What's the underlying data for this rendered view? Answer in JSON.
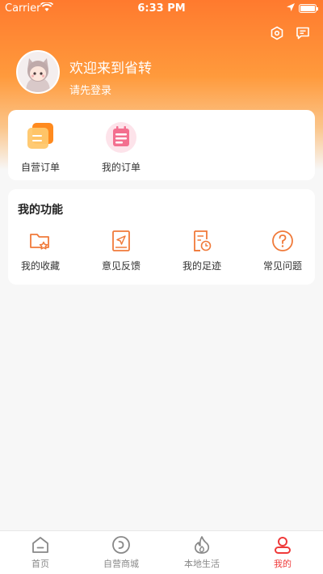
{
  "status_bar": {
    "carrier": "Carrier",
    "time": "6:33 PM"
  },
  "header": {
    "welcome": "欢迎来到省转",
    "login_prompt": "请先登录"
  },
  "orders": [
    {
      "label": "自营订单",
      "icon": "self-order-icon"
    },
    {
      "label": "我的订单",
      "icon": "my-order-icon"
    }
  ],
  "features": {
    "title": "我的功能",
    "items": [
      {
        "label": "我的收藏",
        "icon": "favorites-icon"
      },
      {
        "label": "意见反馈",
        "icon": "feedback-icon"
      },
      {
        "label": "我的足迹",
        "icon": "footprint-icon"
      },
      {
        "label": "常见问题",
        "icon": "faq-icon"
      }
    ]
  },
  "tabbar": [
    {
      "label": "首页",
      "icon": "home-icon"
    },
    {
      "label": "自营商城",
      "icon": "mall-icon"
    },
    {
      "label": "本地生活",
      "icon": "fire-icon"
    },
    {
      "label": "我的",
      "icon": "profile-icon",
      "active": true
    }
  ],
  "colors": {
    "accent": "#ff7a2e",
    "active_tab": "#ef3a3a",
    "icon_orange": "#f07a3a"
  }
}
